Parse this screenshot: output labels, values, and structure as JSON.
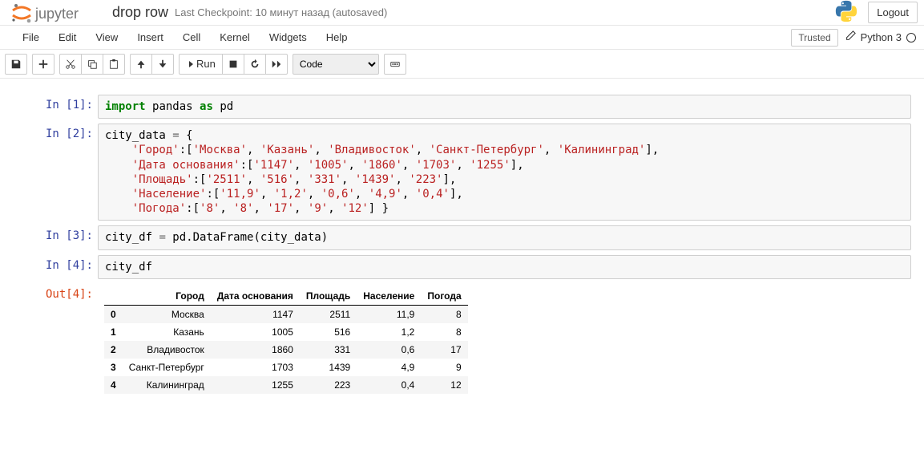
{
  "header": {
    "notebook_name": "drop row",
    "checkpoint": "Last Checkpoint: 10 минут назад  (autosaved)",
    "logout": "Logout"
  },
  "menubar": {
    "items": [
      "File",
      "Edit",
      "View",
      "Insert",
      "Cell",
      "Kernel",
      "Widgets",
      "Help"
    ],
    "trusted": "Trusted",
    "kernel": "Python 3"
  },
  "toolbar": {
    "run_label": "Run",
    "cell_type": "Code"
  },
  "cells": [
    {
      "prompt": "In [1]:",
      "type": "code",
      "code_html": "<span class='kw'>import</span> <span class='nn'>pandas</span> <span class='kw'>as</span> <span class='nn'>pd</span>"
    },
    {
      "prompt": "In [2]:",
      "type": "code",
      "code_html": "city_data <span class='o'>=</span> {\n    <span class='s'>'Город'</span>:[<span class='s'>'Москва'</span>, <span class='s'>'Казань'</span>, <span class='s'>'Владивосток'</span>, <span class='s'>'Санкт-Петербург'</span>, <span class='s'>'Калининград'</span>],\n    <span class='s'>'Дата основания'</span>:[<span class='s'>'1147'</span>, <span class='s'>'1005'</span>, <span class='s'>'1860'</span>, <span class='s'>'1703'</span>, <span class='s'>'1255'</span>],\n    <span class='s'>'Площадь'</span>:[<span class='s'>'2511'</span>, <span class='s'>'516'</span>, <span class='s'>'331'</span>, <span class='s'>'1439'</span>, <span class='s'>'223'</span>],\n    <span class='s'>'Население'</span>:[<span class='s'>'11,9'</span>, <span class='s'>'1,2'</span>, <span class='s'>'0,6'</span>, <span class='s'>'4,9'</span>, <span class='s'>'0,4'</span>],\n    <span class='s'>'Погода'</span>:[<span class='s'>'8'</span>, <span class='s'>'8'</span>, <span class='s'>'17'</span>, <span class='s'>'9'</span>, <span class='s'>'12'</span>] }"
    },
    {
      "prompt": "In [3]:",
      "type": "code",
      "code_html": "city_df <span class='o'>=</span> pd.DataFrame(city_data)"
    },
    {
      "prompt": "In [4]:",
      "type": "code",
      "code_html": "city_df"
    }
  ],
  "output": {
    "prompt": "Out[4]:",
    "columns": [
      "",
      "Город",
      "Дата основания",
      "Площадь",
      "Население",
      "Погода"
    ],
    "rows": [
      [
        "0",
        "Москва",
        "1147",
        "2511",
        "11,9",
        "8"
      ],
      [
        "1",
        "Казань",
        "1005",
        "516",
        "1,2",
        "8"
      ],
      [
        "2",
        "Владивосток",
        "1860",
        "331",
        "0,6",
        "17"
      ],
      [
        "3",
        "Санкт-Петербург",
        "1703",
        "1439",
        "4,9",
        "9"
      ],
      [
        "4",
        "Калининград",
        "1255",
        "223",
        "0,4",
        "12"
      ]
    ]
  }
}
